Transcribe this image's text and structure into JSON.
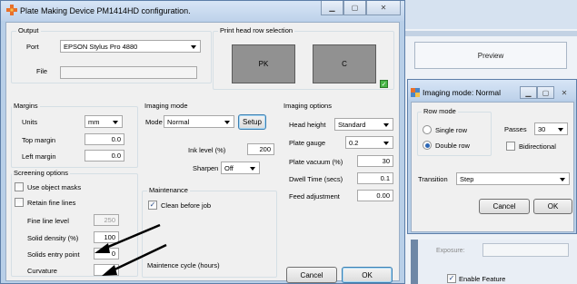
{
  "background_window": {
    "preview_label": "Preview",
    "exposure_label": "Exposure:",
    "exposure_value": "",
    "enable_feature_label": "Enable Feature",
    "enable_feature_checked": true
  },
  "main_window": {
    "title": "Plate Making Device PM1414HD configuration.",
    "output": {
      "title": "Output",
      "port_label": "Port",
      "port_value": "EPSON Stylus Pro 4880",
      "file_label": "File",
      "file_value": ""
    },
    "print_head": {
      "title": "Print head row selection",
      "heads": [
        "PK",
        "C"
      ],
      "checked": true
    },
    "margins": {
      "title": "Margins",
      "units_label": "Units",
      "units_value": "mm",
      "top_label": "Top margin",
      "top_value": "0.0",
      "left_label": "Left margin",
      "left_value": "0.0"
    },
    "screening": {
      "title": "Screening options",
      "use_object_masks_label": "Use object masks",
      "use_object_masks": false,
      "retain_fine_lines_label": "Retain fine lines",
      "retain_fine_lines": false,
      "fine_line_level_label": "Fine line level",
      "fine_line_level_value": "250",
      "solid_density_label": "Solid density (%)",
      "solid_density_value": "100",
      "solids_entry_label": "Solids entry point",
      "solids_entry_value": "0",
      "curvature_label": "Curvature",
      "curvature_value": "0"
    },
    "imaging_mode": {
      "title": "Imaging mode",
      "mode_label": "Mode",
      "mode_value": "Normal",
      "setup_label": "Setup",
      "ink_level_label": "Ink level (%)",
      "ink_level_value": "200",
      "sharpen_label": "Sharpen",
      "sharpen_value": "Off"
    },
    "maintenance": {
      "title": "Maintenance",
      "clean_label": "Clean before job",
      "clean_checked": true,
      "cycle_label": "Maintence cycle (hours)"
    },
    "imaging_options": {
      "title": "Imaging options",
      "head_height_label": "Head height",
      "head_height_value": "Standard",
      "plate_gauge_label": "Plate gauge",
      "plate_gauge_value": "0.2",
      "plate_vacuum_label": "Plate vacuum (%)",
      "plate_vacuum_value": "30",
      "dwell_label": "Dwell Time (secs)",
      "dwell_value": "0.1",
      "feed_label": "Feed adjustment",
      "feed_value": "0.00"
    },
    "cancel_label": "Cancel",
    "ok_label": "OK"
  },
  "imaging_dialog": {
    "title": "Imaging mode: Normal",
    "row_mode_title": "Row mode",
    "single_row_label": "Single row",
    "double_row_label": "Double row",
    "selected_row_mode": "Double row",
    "passes_label": "Passes",
    "passes_value": "30",
    "bidirectional_label": "Bidirectional",
    "bidirectional_checked": false,
    "transition_label": "Transition",
    "transition_value": "Step",
    "cancel_label": "Cancel",
    "ok_label": "OK"
  },
  "colors": {
    "title_bar": "#bed2ea",
    "head_fill": "#919191",
    "green_indicator": "#48b648"
  }
}
